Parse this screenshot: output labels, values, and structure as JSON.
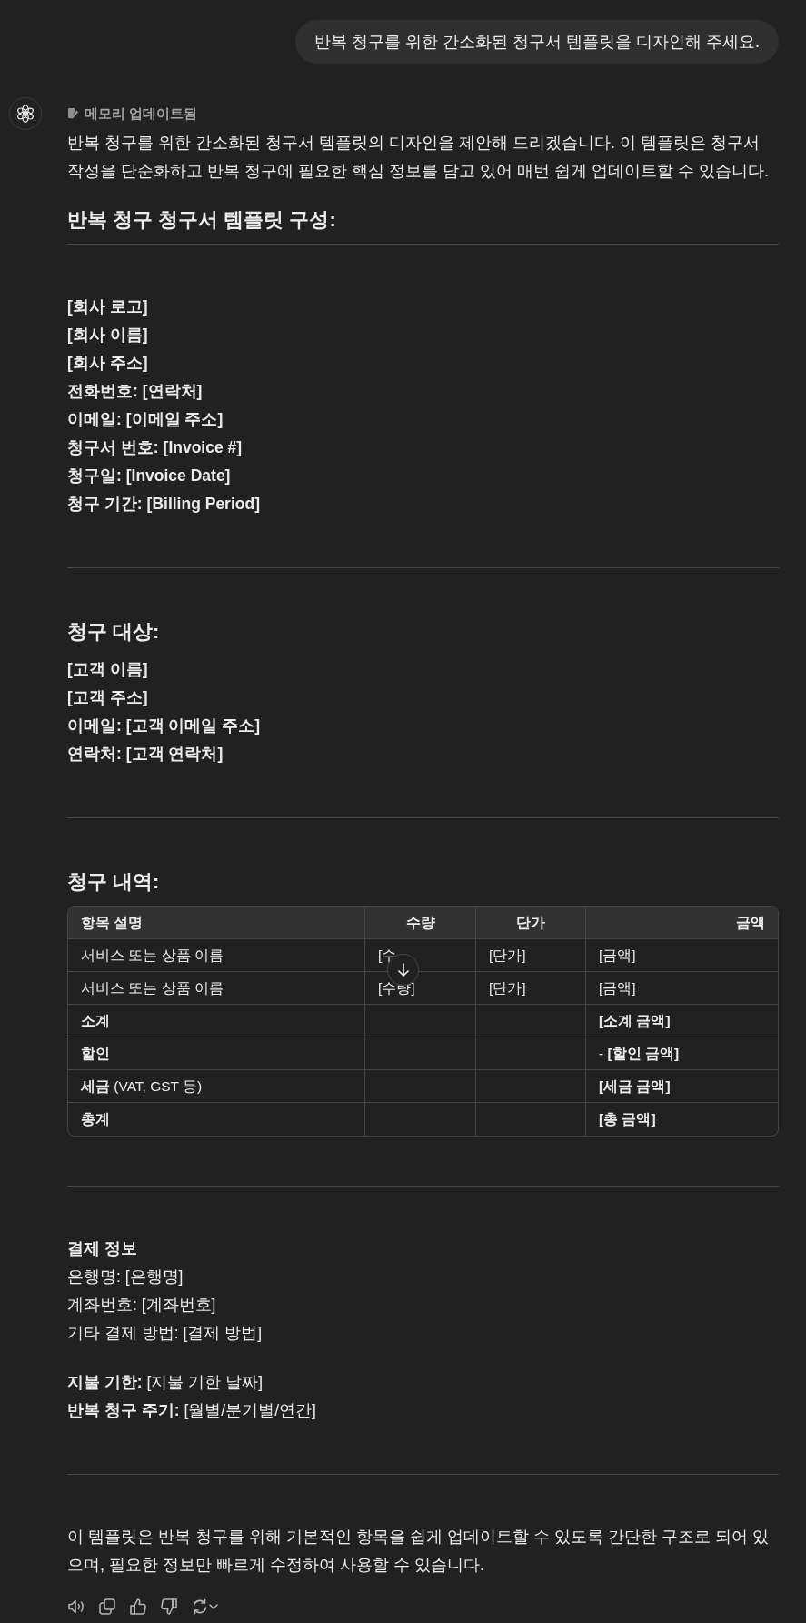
{
  "user_message": "반복 청구를 위한 간소화된 청구서 템플릿을 디자인해 주세요.",
  "assistant": {
    "memory_status": "메모리 업데이트됨",
    "blocks": [
      {
        "kind": "paragraph",
        "text": "반복 청구를 위한 간소화된 청구서 템플릿의 디자인을 제안해 드리겠습니다. 이 템플릿은 청구서 작성을 단순화하고 반복 청구에 필요한 핵심 정보를 담고 있어 매번 쉽게 업데이트할 수 있습니다."
      },
      {
        "kind": "heading",
        "text": "반복 청구 청구서 템플릿 구성:"
      },
      {
        "kind": "divider"
      },
      {
        "kind": "lines",
        "bold": true,
        "lines": [
          "[회사 로고]",
          "[회사 이름]",
          "[회사 주소]",
          "전화번호: [연락처]",
          "이메일: [이메일 주소]",
          "청구서 번호: [Invoice #]",
          "청구일: [Invoice Date]",
          "청구 기간: [Billing Period]"
        ]
      },
      {
        "kind": "divider"
      },
      {
        "kind": "heading",
        "text": "청구 대상:"
      },
      {
        "kind": "lines",
        "bold": true,
        "lines": [
          "[고객 이름]",
          "[고객 주소]",
          "이메일: [고객 이메일 주소]",
          "연락처: [고객 연락처]"
        ]
      },
      {
        "kind": "divider"
      },
      {
        "kind": "heading",
        "text": "청구 내역:"
      },
      {
        "kind": "table",
        "columns": [
          "항목 설명",
          "수량",
          "단가",
          "금액"
        ],
        "rows": [
          {
            "description": {
              "text": "서비스 또는 상품 이름",
              "bold": false
            },
            "quantity": {
              "text": "[수",
              "bold": false
            },
            "unit_price": {
              "text": "[단가]",
              "bold": false
            },
            "amount": {
              "text": "[금액]",
              "bold": false
            }
          },
          {
            "description": {
              "text": "서비스 또는 상품 이름",
              "bold": false
            },
            "quantity": {
              "text": "[수량]",
              "bold": false
            },
            "unit_price": {
              "text": "[단가]",
              "bold": false
            },
            "amount": {
              "text": "[금액]",
              "bold": false
            }
          },
          {
            "description": {
              "text": "소계",
              "bold": true
            },
            "amount": {
              "text": "[소계 금액]",
              "bold": true
            }
          },
          {
            "description": {
              "text": "할인",
              "bold": true
            },
            "amount": {
              "text": "- **[할인 금액]**",
              "bold": false
            }
          },
          {
            "description": {
              "text": "**세금** (VAT, GST 등)",
              "bold": false
            },
            "amount": {
              "text": "[세금 금액]",
              "bold": true
            }
          },
          {
            "description": {
              "text": "총계",
              "bold": true
            },
            "amount": {
              "text": "[총 금액]",
              "bold": true
            }
          }
        ]
      },
      {
        "kind": "divider"
      },
      {
        "kind": "lines",
        "bold": false,
        "title": "결제 정보",
        "lines": [
          "은행명: [은행명]",
          "계좌번호: [계좌번호]",
          "기타 결제 방법: [결제 방법]"
        ]
      },
      {
        "kind": "lines",
        "bold": false,
        "lines": [
          "**지불 기한:** [지불 기한 날짜]",
          "**반복 청구 주기:** [월별/분기별/연간]"
        ]
      },
      {
        "kind": "divider"
      },
      {
        "kind": "paragraph",
        "text": "이 템플릿은 반복 청구를 위해 기본적인 항목을 쉽게 업데이트할 수 있도록 간단한 구조로 되어 있으며, 필요한 정보만 빠르게 수정하여 사용할 수 있습니다."
      }
    ]
  }
}
